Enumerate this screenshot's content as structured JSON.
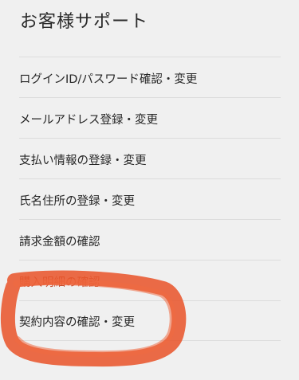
{
  "header": {
    "title": "お客様サポート"
  },
  "menu": {
    "items": [
      {
        "label": "ログインID/パスワード確認・変更"
      },
      {
        "label": "メールアドレス登録・変更"
      },
      {
        "label": "支払い情報の登録・変更"
      },
      {
        "label": "氏名住所の登録・変更"
      },
      {
        "label": "請求金額の確認"
      },
      {
        "label": "購入明細の確認"
      },
      {
        "label": "契約内容の確認・変更"
      }
    ]
  },
  "annotation": {
    "color": "#e8562e",
    "shape": "hand-drawn-circle"
  }
}
